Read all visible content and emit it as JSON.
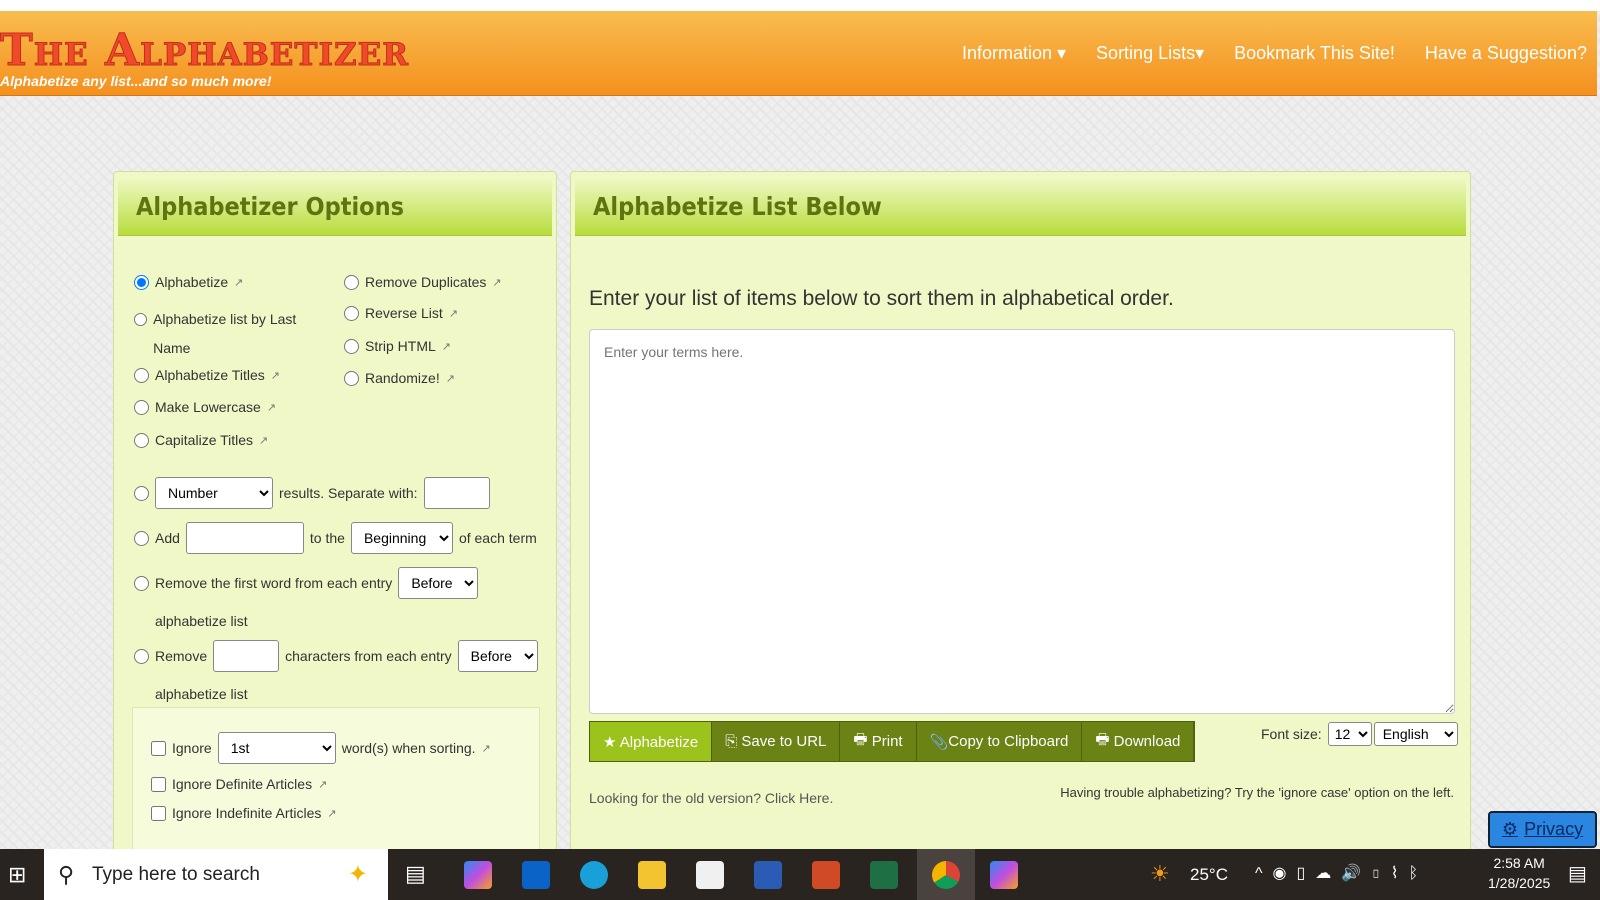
{
  "header": {
    "logo": "The Alphabetizer",
    "tagline": "Alphabetize any list...and so much more!",
    "nav": [
      "Information ▾",
      "Sorting Lists▾",
      "Bookmark This Site!",
      "Have a Suggestion?"
    ]
  },
  "options": {
    "title": "Alphabetizer Options",
    "left": [
      "Alphabetize",
      "Alphabetize list by Last Name",
      "Alphabetize Titles",
      "Make Lowercase",
      "Capitalize Titles"
    ],
    "right": [
      "Remove Duplicates",
      "Reverse List",
      "Strip HTML",
      "Randomize!"
    ],
    "number_select": "Number",
    "results_text": "results. Separate with:",
    "add_label": "Add",
    "to_the": "to the",
    "position_select": "Beginning",
    "of_each_term": "of each term",
    "remove_first_word": "Remove the first word from each entry",
    "before_select": "Before",
    "alphabetize_list": "alphabetize list",
    "remove_label": "Remove",
    "characters_text": "characters from each entry",
    "ignore_label": "Ignore",
    "ignore_select": "1st",
    "words_text": "word(s) when sorting.",
    "ignore_definite": "Ignore Definite Articles",
    "ignore_indefinite": "Ignore Indefinite Articles"
  },
  "list": {
    "title": "Alphabetize List Below",
    "instruction": "Enter your list of items below to sort them in alphabetical order.",
    "placeholder": "Enter your terms here.",
    "buttons": [
      "★ Alphabetize",
      "Save to URL",
      "Print",
      "Copy to Clipboard",
      "Download"
    ],
    "font_size_label": "Font size:",
    "font_size": "12",
    "language": "English",
    "old_version": "Looking for the old version? Click Here.",
    "trouble": "Having trouble alphabetizing? Try the 'ignore case' option on the left."
  },
  "privacy": "Privacy",
  "taskbar": {
    "search_placeholder": "Type here to search",
    "temperature": "25°C",
    "time": "2:58 AM",
    "date": "1/28/2025"
  }
}
